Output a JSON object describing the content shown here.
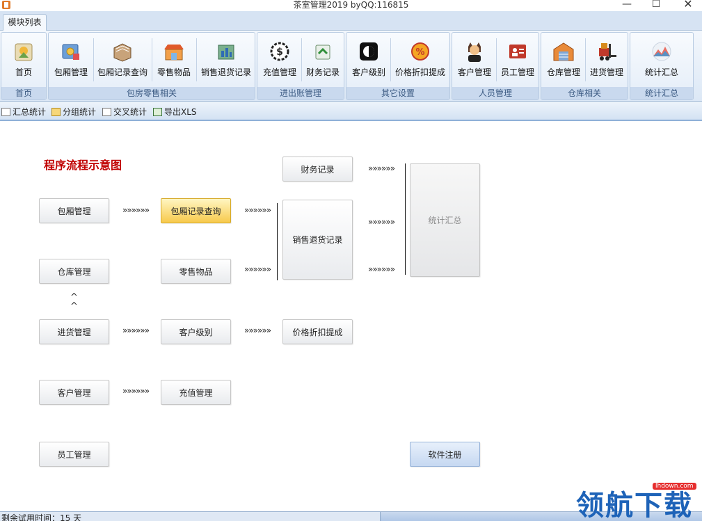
{
  "window": {
    "title": "茶室管理2019 byQQ:116815",
    "min": "—",
    "max": "☐",
    "close": "✕"
  },
  "ribbon": {
    "tab": "模块列表",
    "groups": [
      {
        "label": "首页",
        "buttons": [
          {
            "label": "首页",
            "icon": "home-icon"
          }
        ]
      },
      {
        "label": "包房零售相关",
        "buttons": [
          {
            "label": "包厢管理",
            "icon": "room-icon"
          },
          {
            "label": "包厢记录查询",
            "icon": "records-icon"
          },
          {
            "label": "零售物品",
            "icon": "shop-icon"
          },
          {
            "label": "销售退货记录",
            "icon": "return-icon"
          }
        ]
      },
      {
        "label": "进出账管理",
        "buttons": [
          {
            "label": "充值管理",
            "icon": "dollar-gear-icon"
          },
          {
            "label": "财务记录",
            "icon": "finance-icon"
          }
        ]
      },
      {
        "label": "其它设置",
        "buttons": [
          {
            "label": "客户级别",
            "icon": "level-icon"
          },
          {
            "label": "价格折扣提成",
            "icon": "percent-icon"
          }
        ]
      },
      {
        "label": "人员管理",
        "buttons": [
          {
            "label": "客户管理",
            "icon": "customer-icon"
          },
          {
            "label": "员工管理",
            "icon": "staff-icon"
          }
        ]
      },
      {
        "label": "仓库相关",
        "buttons": [
          {
            "label": "仓库管理",
            "icon": "warehouse-icon"
          },
          {
            "label": "进货管理",
            "icon": "forklift-icon"
          }
        ]
      },
      {
        "label": "统计汇总",
        "buttons": [
          {
            "label": "统计汇总",
            "icon": "chart-icon"
          }
        ]
      }
    ]
  },
  "toolbar": {
    "summary": "汇总统计",
    "group": "分组统计",
    "cross": "交叉统计",
    "export": "导出XLS"
  },
  "diagram": {
    "title": "程序流程示意图",
    "arrow": "»»»»»»",
    "up_chevrons": "^",
    "nodes": {
      "room_mgmt": "包厢管理",
      "room_records": "包厢记录查询",
      "warehouse": "仓库管理",
      "retail": "零售物品",
      "purchase": "进货管理",
      "customer_level": "客户级别",
      "customer_mgmt": "客户管理",
      "recharge": "充值管理",
      "staff": "员工管理",
      "finance": "财务记录",
      "sales_return": "销售退货记录",
      "discount": "价格折扣提成",
      "stats": "统计汇总",
      "register": "软件注册"
    }
  },
  "status": {
    "trial": "剩余试用时间：15 天"
  },
  "watermark": {
    "text": "领航下载",
    "site": "lhdown.com"
  }
}
